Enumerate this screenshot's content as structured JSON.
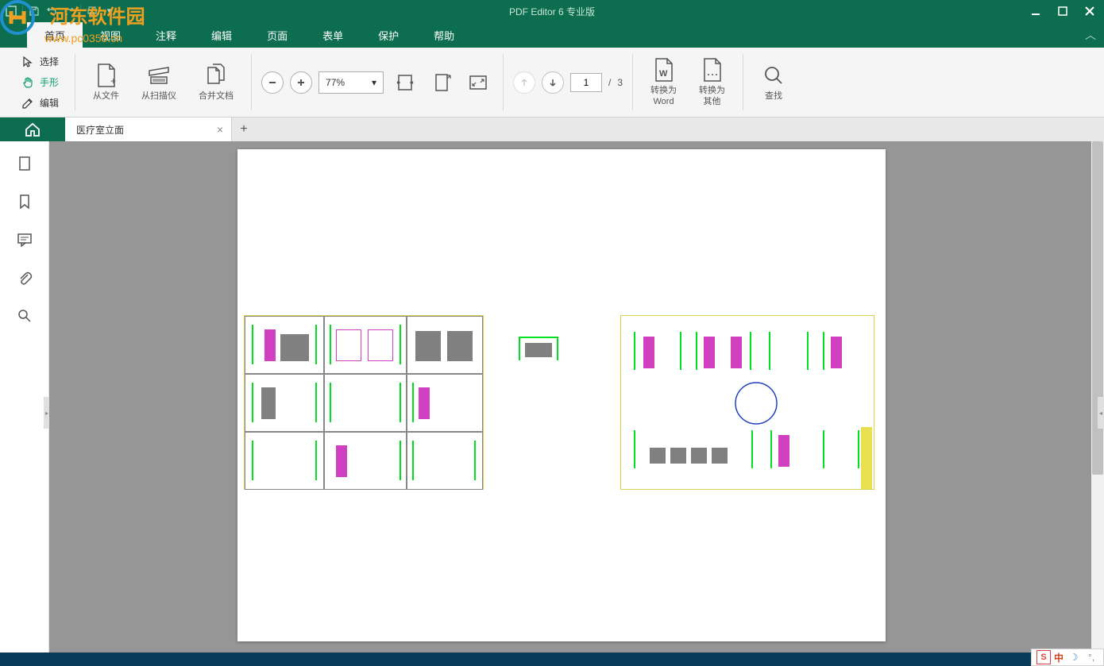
{
  "app": {
    "title": "PDF Editor 6 专业版"
  },
  "watermark": {
    "text": "河东软件园",
    "url": "www.pc0359.cn"
  },
  "menu": {
    "items": [
      "首页",
      "视图",
      "注释",
      "编辑",
      "页面",
      "表单",
      "保护",
      "帮助"
    ],
    "active_index": 0
  },
  "tools": {
    "select": "选择",
    "hand": "手形",
    "edit": "编辑",
    "from_file": "从文件",
    "from_scanner": "从扫描仪",
    "merge": "合并文档",
    "zoom_value": "77%",
    "convert_word_l1": "转换为",
    "convert_word_l2": "Word",
    "convert_other_l1": "转换为",
    "convert_other_l2": "其他",
    "find": "查找"
  },
  "page_nav": {
    "current": "1",
    "total": "3",
    "separator": "/"
  },
  "tabs": {
    "document": "医疗室立面"
  },
  "ime": {
    "label": "中"
  }
}
